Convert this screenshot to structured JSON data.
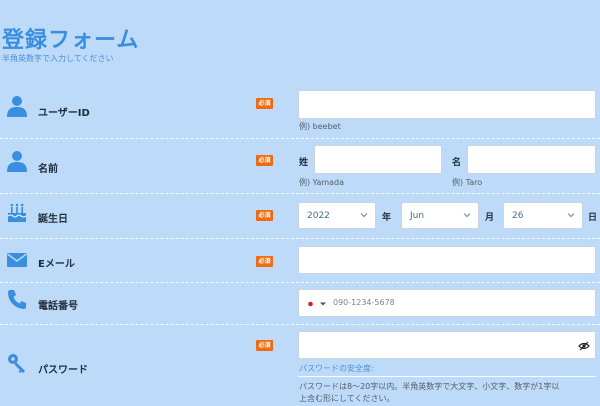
{
  "header": {
    "title": "登録フォーム",
    "subtitle": "半角英数字で入力してください"
  },
  "required_badge": "必須",
  "fields": {
    "userid": {
      "label": "ユーザーID",
      "value": "",
      "hint": "例) beebet",
      "icon": "user-icon"
    },
    "name": {
      "label": "名前",
      "icon": "user-icon",
      "last_label": "姓",
      "last_value": "",
      "last_hint": "例) Yamada",
      "first_label": "名",
      "first_value": "",
      "first_hint": "例) Taro"
    },
    "birthday": {
      "label": "誕生日",
      "icon": "birthday-cake-icon",
      "year": "2022",
      "year_unit": "年",
      "month": "Jun",
      "month_unit": "月",
      "day": "26",
      "day_unit": "日"
    },
    "email": {
      "label": "Eメール",
      "value": "",
      "icon": "mail-icon"
    },
    "phone": {
      "label": "電話番号",
      "placeholder": "090-1234-5678",
      "country_flag": "japan-flag-icon",
      "icon": "phone-icon"
    },
    "password": {
      "label": "パスワード",
      "value": "",
      "icon": "key-icon",
      "strength_label": "パスワードの安全度:",
      "help": "パスワードは8〜20字以内。半角英数字で大文字、小文字、数字が1字以",
      "help2": "上含む形にしてください。"
    }
  },
  "colors": {
    "background": "#bddbf9",
    "accent": "#3a8ee0",
    "badge": "#f26a10"
  }
}
